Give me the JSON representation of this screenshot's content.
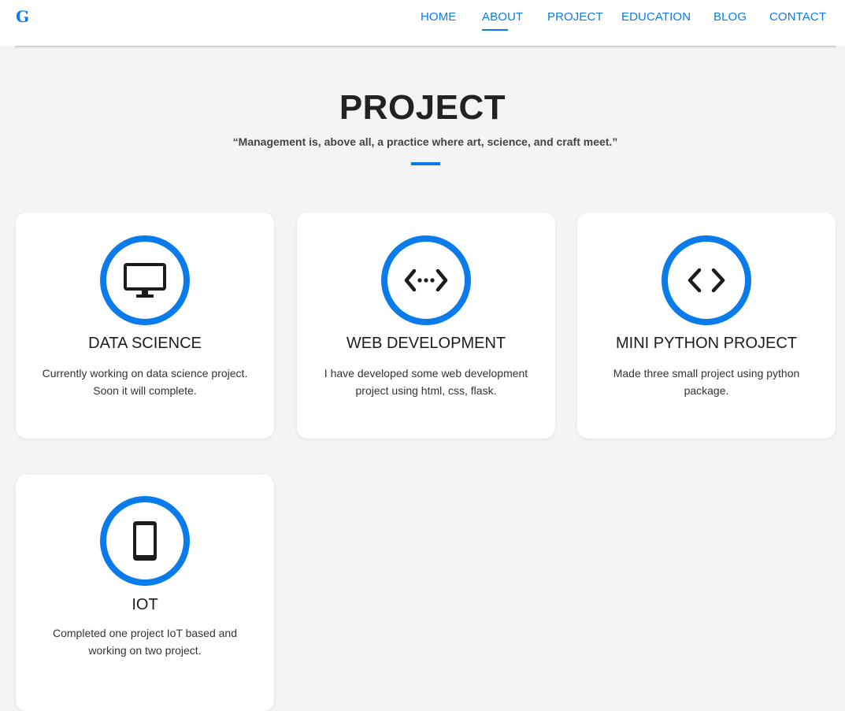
{
  "nav": {
    "logo": "G",
    "items": [
      {
        "label": "HOME"
      },
      {
        "label": "ABOUT"
      },
      {
        "label": "PROJECT"
      },
      {
        "label": "EDUCATION"
      },
      {
        "label": "BLOG"
      },
      {
        "label": "CONTACT"
      }
    ],
    "active_item": "ABOUT"
  },
  "section": {
    "title": "PROJECT",
    "quote": "“Management is, above all, a practice where art, science, and craft meet.”"
  },
  "cards": [
    {
      "icon": "monitor-icon",
      "title": "DATA SCIENCE",
      "desc_line1": "Currently working on data science project.",
      "desc_line2": "Soon it will complete."
    },
    {
      "icon": "web-code-icon",
      "title": "WEB DEVELOPMENT",
      "desc_line1": "I have developed some web development",
      "desc_line2": "project using html, css, flask."
    },
    {
      "icon": "code-icon",
      "title": "MINI PYTHON PROJECT",
      "desc_line1": "Made three small project using python",
      "desc_line2": "package."
    },
    {
      "icon": "tablet-icon",
      "title": "IOT",
      "desc_line1": "Completed one project IoT based and",
      "desc_line2": "working on two project."
    }
  ],
  "colors": {
    "accent": "#0a7bea",
    "background": "#f4f4f4",
    "card": "#ffffff"
  }
}
